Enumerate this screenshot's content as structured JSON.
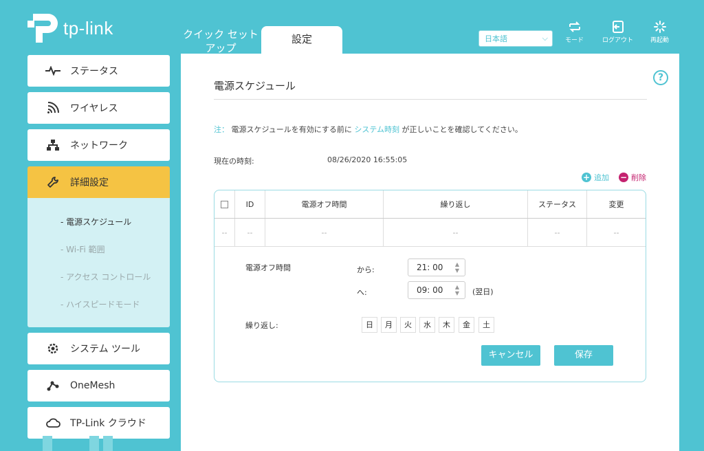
{
  "brand": {
    "name": "tp-link"
  },
  "top_tabs": [
    {
      "label": "クイック セット アップ",
      "active": false
    },
    {
      "label": "設定",
      "active": true
    }
  ],
  "language": {
    "value": "日本語"
  },
  "header_buttons": {
    "mode": {
      "label": "モード",
      "icon": "mode-icon"
    },
    "logout": {
      "label": "ログアウト",
      "icon": "logout-icon"
    },
    "reboot": {
      "label": "再起動",
      "icon": "reboot-icon"
    }
  },
  "sidebar": {
    "items": [
      {
        "label": "ステータス",
        "icon": "pulse-icon"
      },
      {
        "label": "ワイヤレス",
        "icon": "wifi-icon"
      },
      {
        "label": "ネットワーク",
        "icon": "network-icon"
      },
      {
        "label": "詳細設定",
        "icon": "wrench-icon",
        "active": true
      },
      {
        "label": "システム ツール",
        "icon": "gear-icon"
      },
      {
        "label": "OneMesh",
        "icon": "mesh-icon"
      },
      {
        "label": "TP-Link クラウド",
        "icon": "cloud-icon"
      }
    ],
    "sub_items": [
      {
        "label": "- 電源スケジュール",
        "active": true
      },
      {
        "label": "- Wi-Fi 範囲"
      },
      {
        "label": "- アクセス コントロール"
      },
      {
        "label": "- ハイスピードモード"
      }
    ]
  },
  "main": {
    "title": "電源スケジュール",
    "note_prefix": "注：",
    "note_text_1": "電源スケジュールを有効にする前に",
    "note_link": "システム時刻",
    "note_text_2": "が正しいことを確認してください。",
    "current_time_label": "現在の時刻:",
    "current_time_value": "08/26/2020 16:55:05",
    "add_label": "追加",
    "delete_label": "削除",
    "table": {
      "headers": [
        "ID",
        "電源オフ時間",
        "繰り返し",
        "ステータス",
        "変更"
      ],
      "row": [
        "--",
        "--",
        "--",
        "--",
        "--",
        "--"
      ]
    },
    "form": {
      "off_time_label": "電源オフ時間",
      "from_label": "から:",
      "from_value": "21: 00",
      "to_label": "へ:",
      "to_value": "09: 00",
      "next_day": "(翌日)",
      "repeat_label": "繰り返し:",
      "days": [
        "日",
        "月",
        "火",
        "水",
        "木",
        "金",
        "土"
      ],
      "cancel_label": "キャンセル",
      "save_label": "保存"
    }
  },
  "colors": {
    "accent": "#4fc3d2",
    "active_nav": "#f5c343",
    "delete": "#c4226f"
  }
}
